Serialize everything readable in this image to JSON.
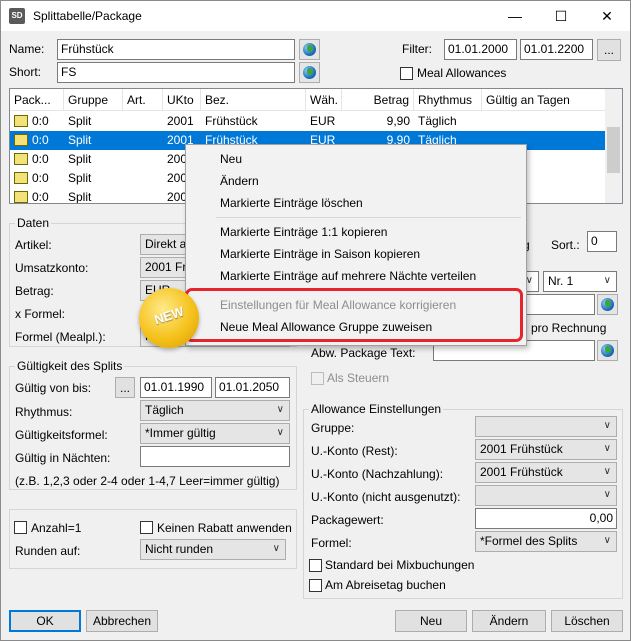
{
  "window": {
    "title": "Splittabelle/Package",
    "app_icon": "SD"
  },
  "header": {
    "name_label": "Name:",
    "name_value": "Frühstück",
    "short_label": "Short:",
    "short_value": "FS",
    "filter_label": "Filter:",
    "filter_from": "01.01.2000",
    "filter_to": "01.01.2200",
    "filter_button": "...",
    "meal_allowances_label": "Meal Allowances"
  },
  "grid": {
    "columns": [
      "Pack...",
      "Gruppe",
      "Art.",
      "UKto",
      "Bez.",
      "Wäh.",
      "Betrag",
      "Rhythmus",
      "Gültig an Tagen"
    ],
    "rows": [
      {
        "pack": "0:0",
        "gruppe": "Split",
        "art": "",
        "ukto": "2001",
        "bez": "Frühstück",
        "waeh": "EUR",
        "betrag": "9,90",
        "rhythmus": "Täglich"
      },
      {
        "pack": "0:0",
        "gruppe": "Split",
        "art": "",
        "ukto": "2001",
        "bez": "Frühstück",
        "waeh": "EUR",
        "betrag": "9,90",
        "rhythmus": "Täglich"
      },
      {
        "pack": "0:0",
        "gruppe": "Split",
        "art": "",
        "ukto": "200",
        "bez": "",
        "waeh": "",
        "betrag": "",
        "rhythmus": ""
      },
      {
        "pack": "0:0",
        "gruppe": "Split",
        "art": "",
        "ukto": "200",
        "bez": "",
        "waeh": "",
        "betrag": "",
        "rhythmus": ""
      },
      {
        "pack": "0:0",
        "gruppe": "Split",
        "art": "",
        "ukto": "200",
        "bez": "",
        "waeh": "",
        "betrag": "",
        "rhythmus": ""
      }
    ]
  },
  "context_menu": {
    "items": [
      "Neu",
      "Ändern",
      "Markierte Einträge löschen",
      "Markierte Einträge 1:1 kopieren",
      "Markierte Einträge in Saison kopieren",
      "Markierte Einträge auf mehrere Nächte verteilen",
      "Einstellungen für Meal Allowance korrigieren",
      "Neue Meal Allowance Gruppe zuweisen"
    ],
    "badge": "NEW"
  },
  "daten": {
    "title": "Daten",
    "artikel_label": "Artikel:",
    "artikel_value": "Direkt au",
    "umsatzkonto_label": "Umsatzkonto:",
    "umsatzkonto_value": "2001 Frü",
    "betrag_label": "Betrag:",
    "betrag_value": "EUR",
    "xformel_label": "x Formel:",
    "formel_label": "Formel (Mealpl.):",
    "formel_value": "K"
  },
  "right_top": {
    "sort_label": "Sort.:",
    "sort_value": "0",
    "g_label": "g",
    "nr_value": "Nr. 1",
    "pro_rechnung": "t. pro Rechnung",
    "abw_label": "Abw. Package Text:",
    "als_steuern": "Als Steuern"
  },
  "gueltigkeit": {
    "title": "Gültigkeit des Splits",
    "von_bis_label": "Gültig von bis:",
    "von": "01.01.1990",
    "bis": "01.01.2050",
    "dots": "...",
    "rhythmus_label": "Rhythmus:",
    "rhythmus_value": "Täglich",
    "formel_label": "Gültigkeitsformel:",
    "formel_value": "*Immer gültig",
    "naechte_label": "Gültig in Nächten:",
    "hint": "(z.B. 1,2,3 oder 2-4 oder 1-4,7  Leer=immer gültig)"
  },
  "misc": {
    "anzahl_label": "Anzahl=1",
    "rabatt_label": "Keinen Rabatt anwenden",
    "runden_label": "Runden auf:",
    "runden_value": "Nicht runden"
  },
  "allowance": {
    "title": "Allowance Einstellungen",
    "gruppe_label": "Gruppe:",
    "konto_rest_label": "U.-Konto (Rest):",
    "konto_rest_value": "2001 Frühstück",
    "konto_nach_label": "U.-Konto (Nachzahlung):",
    "konto_nach_value": "2001 Frühstück",
    "konto_nicht_label": "U.-Konto (nicht ausgenutzt):",
    "wert_label": "Packagewert:",
    "wert_value": "0,00",
    "formel_label": "Formel:",
    "formel_value": "*Formel des Splits",
    "mix_label": "Standard bei Mixbuchungen",
    "abreise_label": "Am Abreisetag buchen"
  },
  "footer": {
    "ok": "OK",
    "abbrechen": "Abbrechen",
    "neu": "Neu",
    "aendern": "Ändern",
    "loeschen": "Löschen"
  }
}
